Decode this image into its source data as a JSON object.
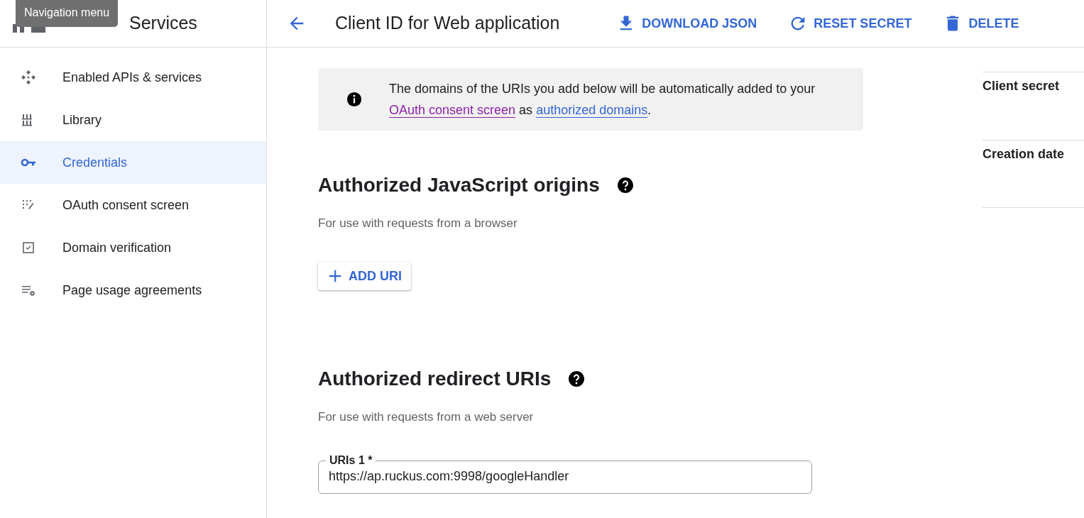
{
  "tooltip": {
    "text": "Navigation menu"
  },
  "sidebar": {
    "title": "Services",
    "items": [
      {
        "label": "Enabled APIs & services",
        "selected": false
      },
      {
        "label": "Library",
        "selected": false
      },
      {
        "label": "Credentials",
        "selected": true
      },
      {
        "label": "OAuth consent screen",
        "selected": false
      },
      {
        "label": "Domain verification",
        "selected": false
      },
      {
        "label": "Page usage agreements",
        "selected": false
      }
    ]
  },
  "header": {
    "title": "Client ID for Web application",
    "actions": [
      {
        "label": "DOWNLOAD JSON"
      },
      {
        "label": "RESET SECRET"
      },
      {
        "label": "DELETE"
      }
    ]
  },
  "info": {
    "before": "The domains of the URIs you add below will be automatically added to your ",
    "links": [
      {
        "text": "OAuth consent screen",
        "visited": true
      },
      {
        "text": "authorized domains",
        "visited": false
      }
    ],
    "between": " as ",
    "after": "."
  },
  "sections": [
    {
      "title": "Authorized JavaScript origins",
      "subtitle": "For use with requests from a browser",
      "button": "ADD URI"
    },
    {
      "title": "Authorized redirect URIs",
      "subtitle": "For use with requests from a web server",
      "fields": [
        {
          "label": "URIs 1 *",
          "value": "https://ap.ruckus.com:9998/googleHandler"
        }
      ]
    }
  ],
  "side_panel": [
    "Client secret",
    "Creation date"
  ]
}
